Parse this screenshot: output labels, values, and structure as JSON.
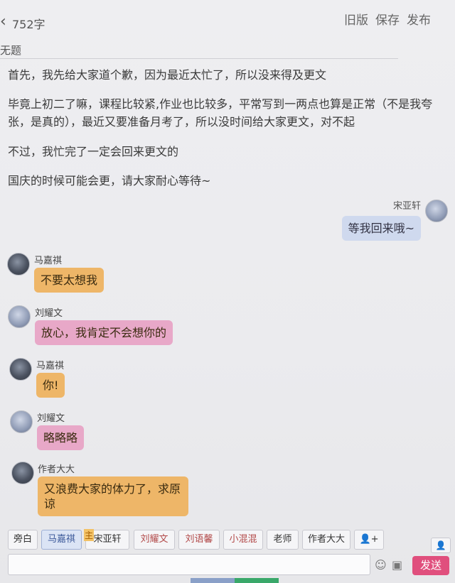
{
  "header": {
    "back_icon": "chevron-left-icon",
    "word_count": "752字",
    "actions": [
      "旧版",
      "保存",
      "发布"
    ],
    "title": "无题"
  },
  "body": {
    "paragraphs": [
      "首先，我先给大家道个歉，因为最近太忙了，所以没来得及更文",
      "毕竟上初二了嘛，课程比较紧,作业也比较多，平常写到一两点也算是正常（不是我夸张，是真的），最近又要准备月考了，所以没时间给大家更文，对不起",
      "不过，我忙完了一定会回来更文的",
      "国庆的时候可能会更，请大家耐心等待~"
    ]
  },
  "chat": [
    {
      "speaker": "宋亚轩",
      "side": "right",
      "text": "等我回来哦~",
      "color": "#cfd9ee"
    },
    {
      "speaker": "马嘉祺",
      "side": "left",
      "text": "不要太想我",
      "color": "#eeb668"
    },
    {
      "speaker": "刘耀文",
      "side": "left",
      "text": "放心，我肯定不会想你的",
      "color": "#e8a8c8"
    },
    {
      "speaker": "马嘉祺",
      "side": "left",
      "text": "你!",
      "color": "#eeb668"
    },
    {
      "speaker": "刘耀文",
      "side": "left",
      "text": "略略略",
      "color": "#e8a8c8"
    },
    {
      "speaker": "作者大大",
      "side": "left",
      "text": "又浪费大家的体力了，求原谅",
      "color": "#eeb668"
    }
  ],
  "roles": {
    "items": [
      "旁白",
      "马嘉祺",
      "宋亚轩",
      "刘耀文",
      "刘语馨",
      "小混混",
      "老师",
      "作者大大"
    ],
    "main_mark": "主",
    "add_role_icon": "add-person-icon"
  },
  "composer": {
    "placeholder": "",
    "emoji_icon": "smiley-icon",
    "image_icon": "image-icon",
    "send_label": "发送",
    "person_icon": "person-icon"
  }
}
